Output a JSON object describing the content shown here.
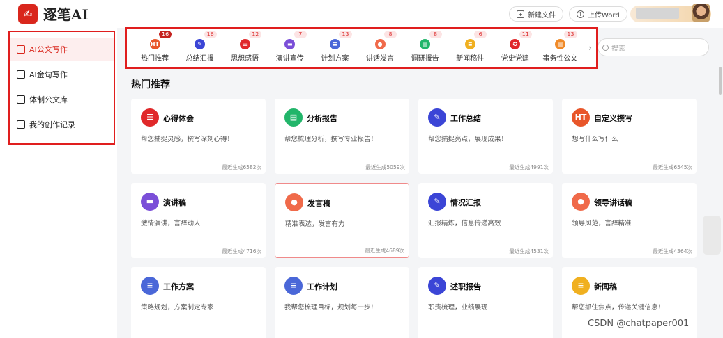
{
  "app": {
    "logo_mark": "✍",
    "title": "逐笔AI"
  },
  "header": {
    "new_file": "新建文件",
    "upload": "上传Word"
  },
  "sidebar": {
    "items": [
      {
        "label": "AI公文写作",
        "icon": "ai-doc-icon",
        "active": true
      },
      {
        "label": "AI金句写作",
        "icon": "quote-icon",
        "active": false
      },
      {
        "label": "体制公文库",
        "icon": "library-icon",
        "active": false
      },
      {
        "label": "我的创作记录",
        "icon": "record-icon",
        "active": false
      }
    ]
  },
  "categories": [
    {
      "label": "热门推荐",
      "badge": "16",
      "color": "#e8562a",
      "glyph": "HT"
    },
    {
      "label": "总结汇报",
      "badge": "16",
      "color": "#3b45d6",
      "glyph": "✎"
    },
    {
      "label": "思想感悟",
      "badge": "12",
      "color": "#e0282a",
      "glyph": "☰"
    },
    {
      "label": "演讲宣传",
      "badge": "7",
      "color": "#7b4fd8",
      "glyph": "▬"
    },
    {
      "label": "计划方案",
      "badge": "13",
      "color": "#4a67d8",
      "glyph": "≡"
    },
    {
      "label": "讲话发言",
      "badge": "8",
      "color": "#f06a4a",
      "glyph": "●"
    },
    {
      "label": "调研报告",
      "badge": "8",
      "color": "#22b56a",
      "glyph": "▤"
    },
    {
      "label": "新闻稿件",
      "badge": "6",
      "color": "#f0b020",
      "glyph": "≡"
    },
    {
      "label": "党史党建",
      "badge": "11",
      "color": "#e0282a",
      "glyph": "✪"
    },
    {
      "label": "事务性公文",
      "badge": "13",
      "color": "#f08a28",
      "glyph": "▤"
    }
  ],
  "search": {
    "placeholder": "搜索"
  },
  "section_title": "热门推荐",
  "cards": [
    {
      "title": "心得体会",
      "desc": "帮您捕捉灵感，撰写深刻心得！",
      "count": "最近生成6582次",
      "color": "#e0282a",
      "glyph": "☰"
    },
    {
      "title": "分析报告",
      "desc": "帮您梳理分析，撰写专业报告！",
      "count": "最近生成5059次",
      "color": "#22b56a",
      "glyph": "▤"
    },
    {
      "title": "工作总结",
      "desc": "帮您捕捉亮点，展现成果！",
      "count": "最近生成4991次",
      "color": "#3b45d6",
      "glyph": "✎"
    },
    {
      "title": "自定义撰写",
      "desc": "想写什么写什么",
      "count": "最近生成6545次",
      "color": "#e8562a",
      "glyph": "HT"
    },
    {
      "title": "演讲稿",
      "desc": "激情演讲，言辞动人",
      "count": "最近生成4716次",
      "color": "#7b4fd8",
      "glyph": "▬"
    },
    {
      "title": "发言稿",
      "desc": "精准表达，发言有力",
      "count": "最近生成4689次",
      "color": "#f06a4a",
      "glyph": "●"
    },
    {
      "title": "情况汇报",
      "desc": "汇报精炼，信息传递高效",
      "count": "最近生成4531次",
      "color": "#3b45d6",
      "glyph": "✎"
    },
    {
      "title": "领导讲话稿",
      "desc": "领导风范，言辞精准",
      "count": "最近生成4364次",
      "color": "#f06a4a",
      "glyph": "●"
    },
    {
      "title": "工作方案",
      "desc": "策略规划，方案制定专家",
      "count": "",
      "color": "#4a67d8",
      "glyph": "≡"
    },
    {
      "title": "工作计划",
      "desc": "我帮您梳理目标，规划每一步！",
      "count": "",
      "color": "#4a67d8",
      "glyph": "≡"
    },
    {
      "title": "述职报告",
      "desc": "职责梳理，业绩展现",
      "count": "",
      "color": "#3b45d6",
      "glyph": "✎"
    },
    {
      "title": "新闻稿",
      "desc": "帮您抓住焦点，传递关键信息！",
      "count": "",
      "color": "#f0b020",
      "glyph": "≡"
    }
  ],
  "watermark": "CSDN @chatpaper001"
}
